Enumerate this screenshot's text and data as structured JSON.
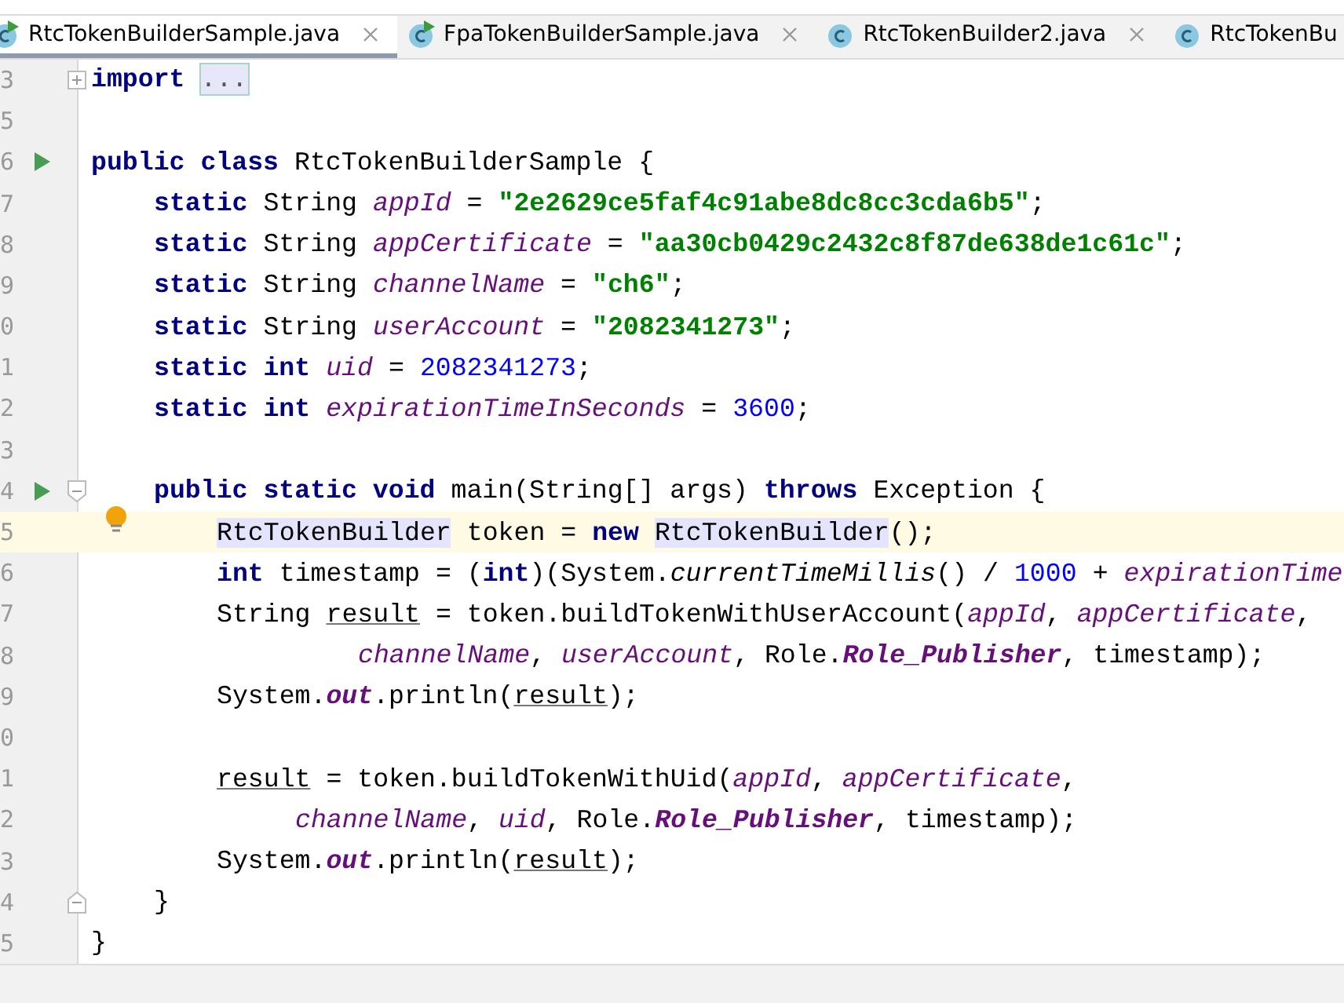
{
  "tabs": [
    {
      "label": "RtcTokenBuilderSample.java",
      "selected": true,
      "kind": "runnable",
      "closable": true
    },
    {
      "label": "FpaTokenBuilderSample.java",
      "selected": false,
      "kind": "runnable",
      "closable": true
    },
    {
      "label": "RtcTokenBuilder2.java",
      "selected": false,
      "kind": "class",
      "closable": true
    },
    {
      "label": "RtcTokenBu",
      "selected": false,
      "kind": "class",
      "closable": false
    }
  ],
  "lines": [
    {
      "num": "3",
      "kind": "top",
      "fold": {
        "kind": "expand"
      },
      "tokens": [
        {
          "t": "import",
          "kind": "kw"
        },
        {
          "t": "...",
          "kind": "folded"
        }
      ]
    },
    {
      "num": "5",
      "kind": "top"
    },
    {
      "num": "6",
      "kind": "top",
      "run": true,
      "tokens": [
        {
          "t": "public class",
          "kind": "kw"
        },
        {
          "t": "RtcTokenBuilderSample {",
          "kind": "plain"
        }
      ]
    },
    {
      "num": "7",
      "kind": "member",
      "tokens": [
        {
          "t": "static",
          "kind": "kw"
        },
        {
          "t": "String",
          "kind": "plain"
        },
        {
          "t": "appId",
          "kind": "field"
        },
        {
          "t": "=",
          "kind": "plain"
        },
        {
          "t": "\"2e2629ce5faf4c91abe8dc8cc3cda6b5\"",
          "kind": "str"
        },
        {
          "t": ";",
          "kind": "glued"
        }
      ]
    },
    {
      "num": "8",
      "kind": "member",
      "tokens": [
        {
          "t": "static",
          "kind": "kw"
        },
        {
          "t": "String",
          "kind": "plain"
        },
        {
          "t": "appCertificate",
          "kind": "field"
        },
        {
          "t": "=",
          "kind": "plain"
        },
        {
          "t": "\"aa30cb0429c2432c8f87de638de1c61c\"",
          "kind": "str"
        },
        {
          "t": ";",
          "kind": "glued"
        }
      ]
    },
    {
      "num": "9",
      "kind": "member",
      "tokens": [
        {
          "t": "static",
          "kind": "kw"
        },
        {
          "t": "String",
          "kind": "plain"
        },
        {
          "t": "channelName",
          "kind": "field"
        },
        {
          "t": "=",
          "kind": "plain"
        },
        {
          "t": "\"ch6\"",
          "kind": "str"
        },
        {
          "t": ";",
          "kind": "glued"
        }
      ]
    },
    {
      "num": "0",
      "kind": "member",
      "tokens": [
        {
          "t": "static",
          "kind": "kw"
        },
        {
          "t": "String",
          "kind": "plain"
        },
        {
          "t": "userAccount",
          "kind": "field"
        },
        {
          "t": "=",
          "kind": "plain"
        },
        {
          "t": "\"2082341273\"",
          "kind": "str"
        },
        {
          "t": ";",
          "kind": "glued"
        }
      ]
    },
    {
      "num": "1",
      "kind": "member",
      "tokens": [
        {
          "t": "static int",
          "kind": "kw"
        },
        {
          "t": "uid",
          "kind": "field"
        },
        {
          "t": "=",
          "kind": "plain"
        },
        {
          "t": "2082341273",
          "kind": "num"
        },
        {
          "t": ";",
          "kind": "glued"
        }
      ]
    },
    {
      "num": "2",
      "kind": "member",
      "tokens": [
        {
          "t": "static int",
          "kind": "kw"
        },
        {
          "t": "expirationTimeInSeconds",
          "kind": "field"
        },
        {
          "t": "=",
          "kind": "plain"
        },
        {
          "t": "3600",
          "kind": "num"
        },
        {
          "t": ";",
          "kind": "glued"
        }
      ]
    },
    {
      "num": "3",
      "kind": "top"
    },
    {
      "num": "4",
      "kind": "member",
      "run": true,
      "fold": {
        "kind": "start"
      },
      "tokens": [
        {
          "t": "public static void",
          "kind": "kw"
        },
        {
          "t": "main(String[] args)",
          "kind": "plain"
        },
        {
          "t": "throws",
          "kind": "kw"
        },
        {
          "t": "Exception {",
          "kind": "plain"
        }
      ]
    },
    {
      "num": "5",
      "kind": "body",
      "current": true,
      "bulb": true,
      "tokens": [
        {
          "t": "RtcTokenBuilder",
          "kind": "hl"
        },
        {
          "t": "token =",
          "kind": "plain"
        },
        {
          "t": "new",
          "kind": "kw"
        },
        {
          "t": "RtcTokenBuilder",
          "kind": "hl"
        },
        {
          "t": "();",
          "kind": "glued"
        }
      ]
    },
    {
      "num": "6",
      "kind": "body",
      "tokens": [
        {
          "t": "int",
          "kind": "kw"
        },
        {
          "t": "timestamp = (",
          "kind": "plain"
        },
        {
          "t": "int",
          "kind": "kwglued"
        },
        {
          "t": ")(System.",
          "kind": "glued"
        },
        {
          "t": "currentTimeMillis",
          "kind": "static"
        },
        {
          "t": "() /",
          "kind": "glued"
        },
        {
          "t": "1000",
          "kind": "num"
        },
        {
          "t": "+",
          "kind": "plain"
        },
        {
          "t": "expirationTime",
          "kind": "field"
        }
      ]
    },
    {
      "num": "7",
      "kind": "body",
      "tokens": [
        {
          "t": "String",
          "kind": "plain"
        },
        {
          "t": "result",
          "kind": "under"
        },
        {
          "t": "= token.buildTokenWithUserAccount(",
          "kind": "plain"
        },
        {
          "t": "appId",
          "kind": "fieldglued"
        },
        {
          "t": ",",
          "kind": "glued"
        },
        {
          "t": "appCertificate",
          "kind": "field"
        },
        {
          "t": ",",
          "kind": "glued"
        }
      ]
    },
    {
      "num": "8",
      "kind": "wrap-wide",
      "tokens": [
        {
          "t": "channelName",
          "kind": "field"
        },
        {
          "t": ",",
          "kind": "glued"
        },
        {
          "t": "userAccount",
          "kind": "field"
        },
        {
          "t": ", Role.",
          "kind": "glued"
        },
        {
          "t": "Role_Publisher",
          "kind": "constglued"
        },
        {
          "t": ", timestamp);",
          "kind": "glued"
        }
      ]
    },
    {
      "num": "9",
      "kind": "body",
      "tokens": [
        {
          "t": "System.",
          "kind": "plain"
        },
        {
          "t": "out",
          "kind": "constglued"
        },
        {
          "t": ".println(",
          "kind": "glued"
        },
        {
          "t": "result",
          "kind": "underglued"
        },
        {
          "t": ");",
          "kind": "glued"
        }
      ]
    },
    {
      "num": "0",
      "kind": "top"
    },
    {
      "num": "1",
      "kind": "body",
      "tokens": [
        {
          "t": "result",
          "kind": "under"
        },
        {
          "t": "= token.buildTokenWithUid(",
          "kind": "plain"
        },
        {
          "t": "appId",
          "kind": "fieldglued"
        },
        {
          "t": ",",
          "kind": "glued"
        },
        {
          "t": "appCertificate",
          "kind": "field"
        },
        {
          "t": ",",
          "kind": "glued"
        }
      ]
    },
    {
      "num": "2",
      "kind": "wrap",
      "tokens": [
        {
          "t": "channelName",
          "kind": "field"
        },
        {
          "t": ",",
          "kind": "glued"
        },
        {
          "t": "uid",
          "kind": "field"
        },
        {
          "t": ", Role.",
          "kind": "glued"
        },
        {
          "t": "Role_Publisher",
          "kind": "constglued"
        },
        {
          "t": ", timestamp);",
          "kind": "glued"
        }
      ]
    },
    {
      "num": "3",
      "kind": "body",
      "tokens": [
        {
          "t": "System.",
          "kind": "plain"
        },
        {
          "t": "out",
          "kind": "constglued"
        },
        {
          "t": ".println(",
          "kind": "glued"
        },
        {
          "t": "result",
          "kind": "underglued"
        },
        {
          "t": ");",
          "kind": "glued"
        }
      ]
    },
    {
      "num": "4",
      "kind": "member",
      "fold": {
        "kind": "end"
      },
      "tokens": [
        {
          "t": "}",
          "kind": "plain"
        }
      ]
    },
    {
      "num": "5",
      "kind": "top",
      "tokens": [
        {
          "t": "}",
          "kind": "plain"
        }
      ]
    }
  ]
}
